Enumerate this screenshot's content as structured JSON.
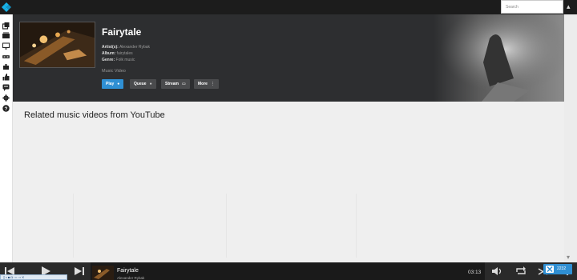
{
  "topbar": {
    "search_placeholder": "Search"
  },
  "sidebar": {
    "items": [
      {
        "icon": "library-icon"
      },
      {
        "icon": "movies-icon"
      },
      {
        "icon": "tv-icon"
      },
      {
        "icon": "music-icon"
      },
      {
        "icon": "addons-icon"
      },
      {
        "icon": "thumbs-up-icon"
      },
      {
        "icon": "chat-icon"
      },
      {
        "icon": "settings-icon"
      },
      {
        "icon": "help-icon"
      }
    ]
  },
  "hero": {
    "title": "Fairytale",
    "artist_label": "Artist(s):",
    "artist": "Alexander Rybak",
    "album_label": "Album:",
    "album": "fairytales",
    "genre_label": "Genre:",
    "genre": "Folk music",
    "type": "Music Video",
    "buttons": {
      "play": "Play",
      "queue": "Queue",
      "stream": "Stream",
      "more": "More"
    }
  },
  "content": {
    "related_heading": "Related music videos from YouTube"
  },
  "player": {
    "now_playing_title": "Fairytale",
    "now_playing_artist": "Alexander Rybak",
    "time": "03:13"
  },
  "badge": {
    "value": "2232"
  },
  "colors": {
    "accent": "#2f8fd3",
    "hero_bg": "#2d2e30",
    "topbar_bg": "#1c1c1c"
  }
}
